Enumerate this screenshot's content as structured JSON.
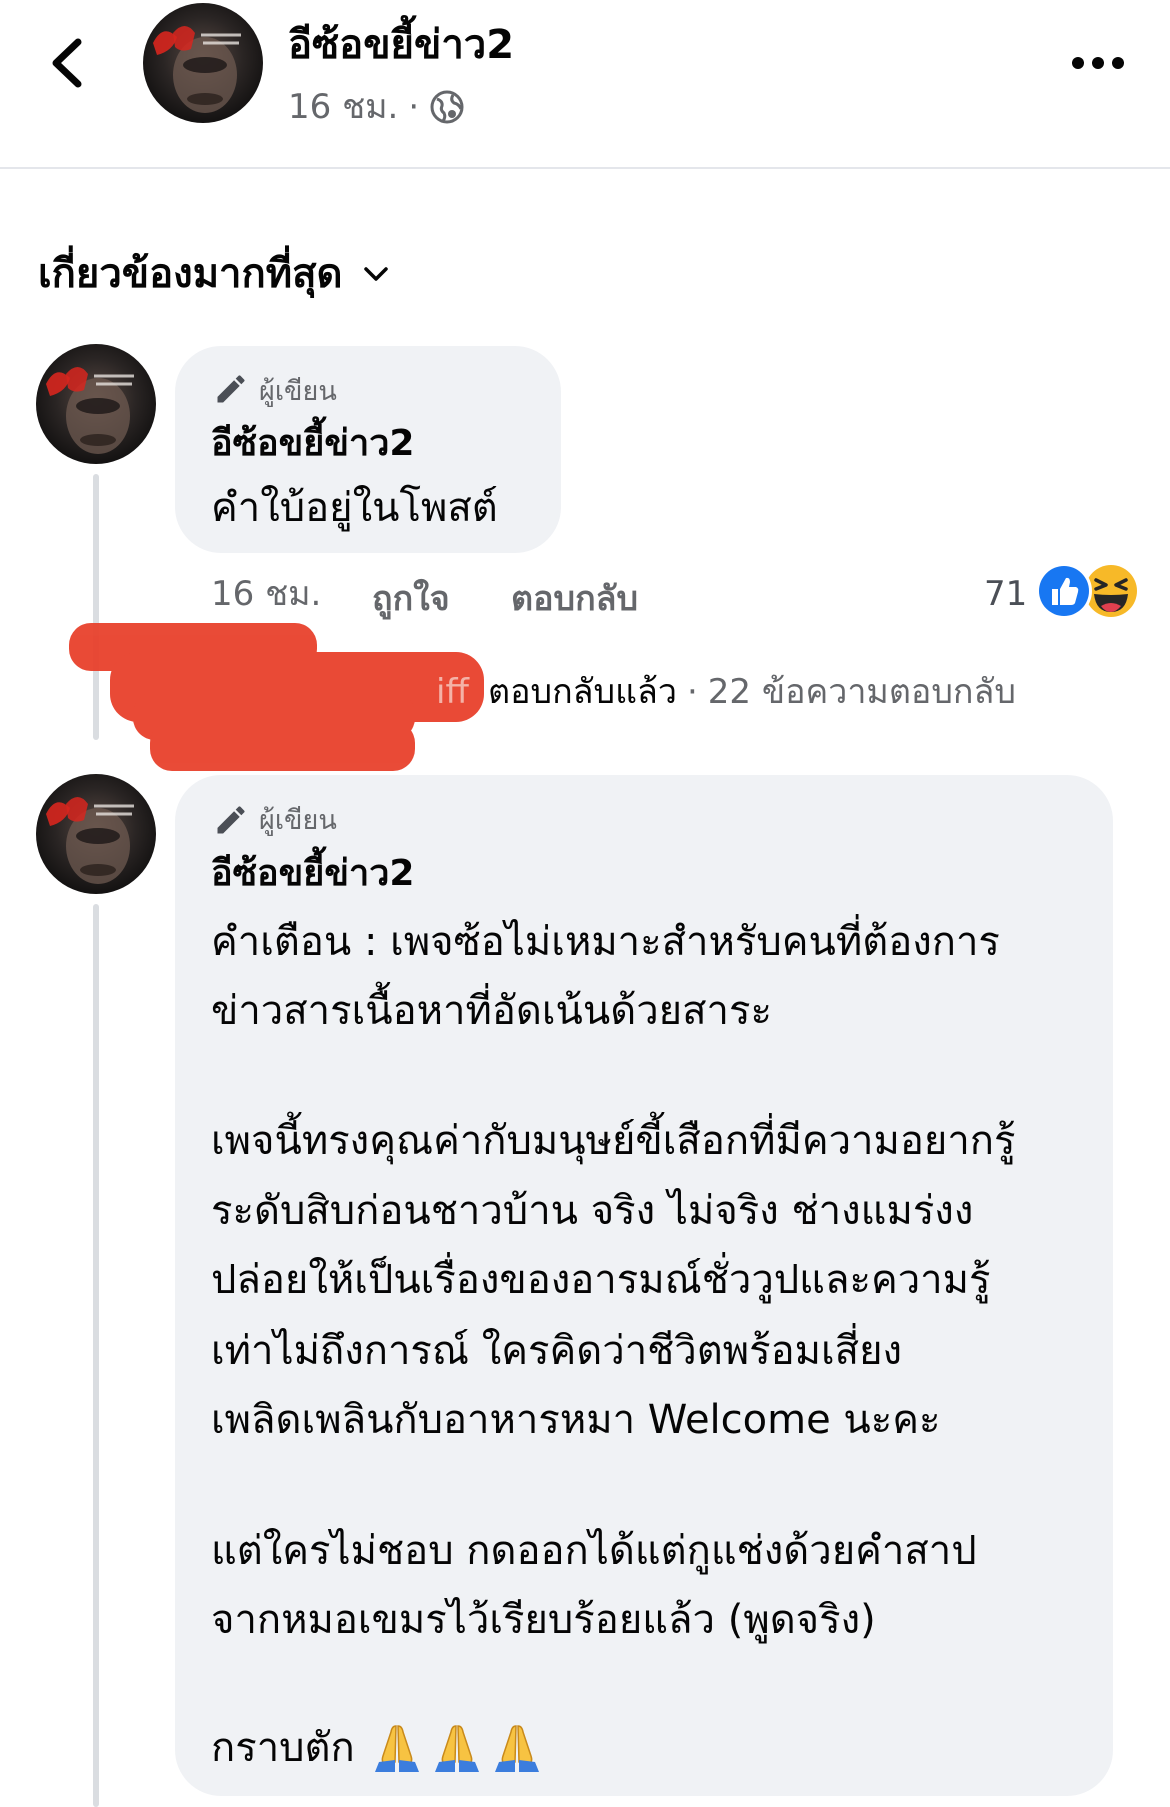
{
  "header": {
    "back_icon": "chevron-left-icon",
    "avatar": "page-avatar",
    "page_name": "อีซ้อขยี้ข่าว2",
    "time": "16 ชม.",
    "separator": "·",
    "privacy_icon": "globe-icon",
    "more_icon": "more-horizontal-icon"
  },
  "sort": {
    "label": "เกี่ยวข้องมากที่สุด",
    "icon": "chevron-down-icon"
  },
  "comments": [
    {
      "badge_icon": "pencil-icon",
      "badge": "ผู้เขียน",
      "author": "อีซ้อขยี้ข่าว2",
      "lines": [
        "คำใบ้อยู่ในโพสต์"
      ],
      "time": "16 ชม.",
      "like_label": "ถูกใจ",
      "reply_label": "ตอบกลับ",
      "reaction_count": "71",
      "reactions": [
        "like-reaction-icon",
        "haha-reaction-icon"
      ]
    },
    {
      "badge_icon": "pencil-icon",
      "badge": "ผู้เขียน",
      "author": "อีซ้อขยี้ข่าว2",
      "lines": [
        "คำเตือน : เพจซ้อไม่เหมาะสำหรับคนที่ต้องการ",
        "ข่าวสารเนื้อหาที่อัดเน้นด้วยสาระ",
        "เพจนี้ทรงคุณค่ากับมนุษย์ขี้เสือกที่มีความอยากรู้",
        "ระดับสิบก่อนชาวบ้าน จริง ไม่จริง ช่างแมร่งง",
        "ปล่อยให้เป็นเรื่องของอารมณ์ชั่ววูปและความรู้",
        "เท่าไม่ถึงการณ์ ใครคิดว่าชีวิตพร้อมเสี่ยง",
        "เพลิดเพลินกับอาหารหมา Welcome นะคะ",
        "แต่ใครไม่ชอบ กดออกได้แต่กูแช่งด้วยคำสาป",
        "จากหมอเขมรไว้เรียบร้อยแล้ว (พูดจริง)",
        "กราบตัก"
      ],
      "emoji": [
        "praying-hands-icon",
        "praying-hands-icon",
        "praying-hands-icon"
      ]
    }
  ],
  "replies_summary": {
    "name_fragment": "iff",
    "replied": "ตอบกลับแล้ว",
    "separator": "·",
    "count_text": "22 ข้อความตอบกลับ"
  },
  "colors": {
    "bubble": "#f0f2f5",
    "text": "#050505",
    "secondary": "#65676b",
    "like_blue": "#1877f2",
    "haha_yellow": "#f7b928",
    "redaction": "#e8412c"
  }
}
